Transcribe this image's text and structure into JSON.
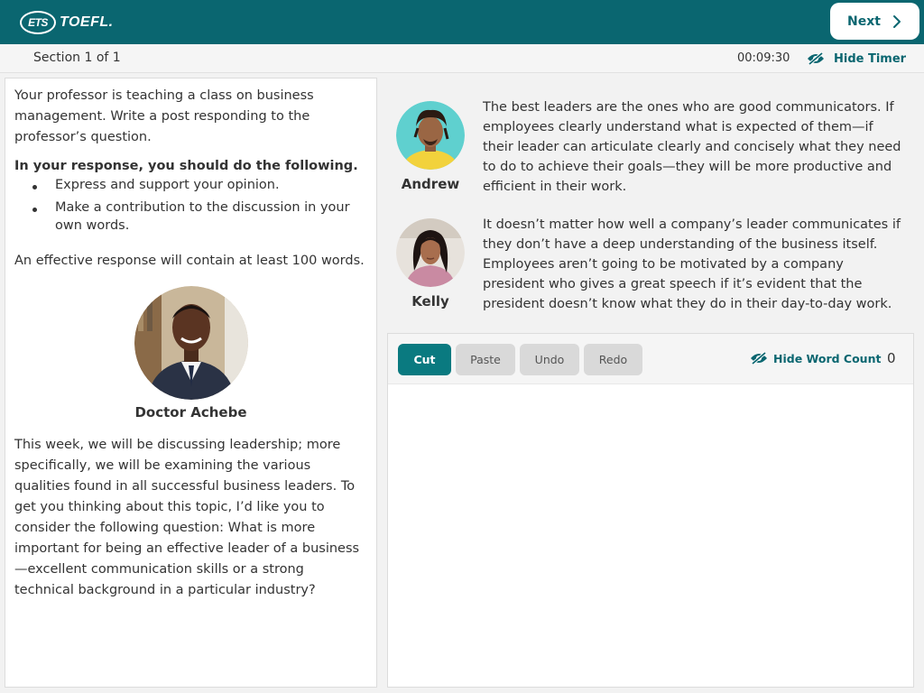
{
  "header": {
    "logo_ets": "ETS",
    "logo_toefl": "TOEFL.",
    "next_label": "Next",
    "brand_color": "#0a6670"
  },
  "section_bar": {
    "section_label": "Section 1 of 1",
    "timer": "00:09:30",
    "hide_timer_label": "Hide Timer"
  },
  "prompt": {
    "intro": "Your professor is teaching a class on business management. Write a post responding to the professor’s question.",
    "instructions_heading": "In your response, you should do the following.",
    "bullets": [
      "Express and support your opinion.",
      "Make a contribution to the discussion in your own words."
    ],
    "length_note": "An effective response will contain at least 100 words."
  },
  "professor": {
    "name": "Doctor Achebe",
    "text": "This week, we will be discussing leadership; more specifically, we will be examining the various qualities found in all successful business leaders. To get you thinking about this topic, I’d like you to consider the following question: What is more important for being an effective leader of a business—excellent communication skills or a strong technical background in a particular industry?"
  },
  "students": [
    {
      "name": "Andrew",
      "text": "The best leaders are the ones who are good communicators. If employees clearly understand what is expected of them—if their leader can articulate clearly and concisely what they need to do to achieve their goals—they will be more productive and efficient in their work."
    },
    {
      "name": "Kelly",
      "text": "It doesn’t matter how well a company’s leader communicates if they don’t have a deep understanding of the business itself. Employees aren’t going to be motivated by a company president who gives a great speech if it’s evident that the president doesn’t know what they do in their day-to-day work."
    }
  ],
  "editor": {
    "cut_label": "Cut",
    "paste_label": "Paste",
    "undo_label": "Undo",
    "redo_label": "Redo",
    "hide_word_count_label": "Hide Word Count",
    "word_count": "0",
    "response_value": ""
  }
}
